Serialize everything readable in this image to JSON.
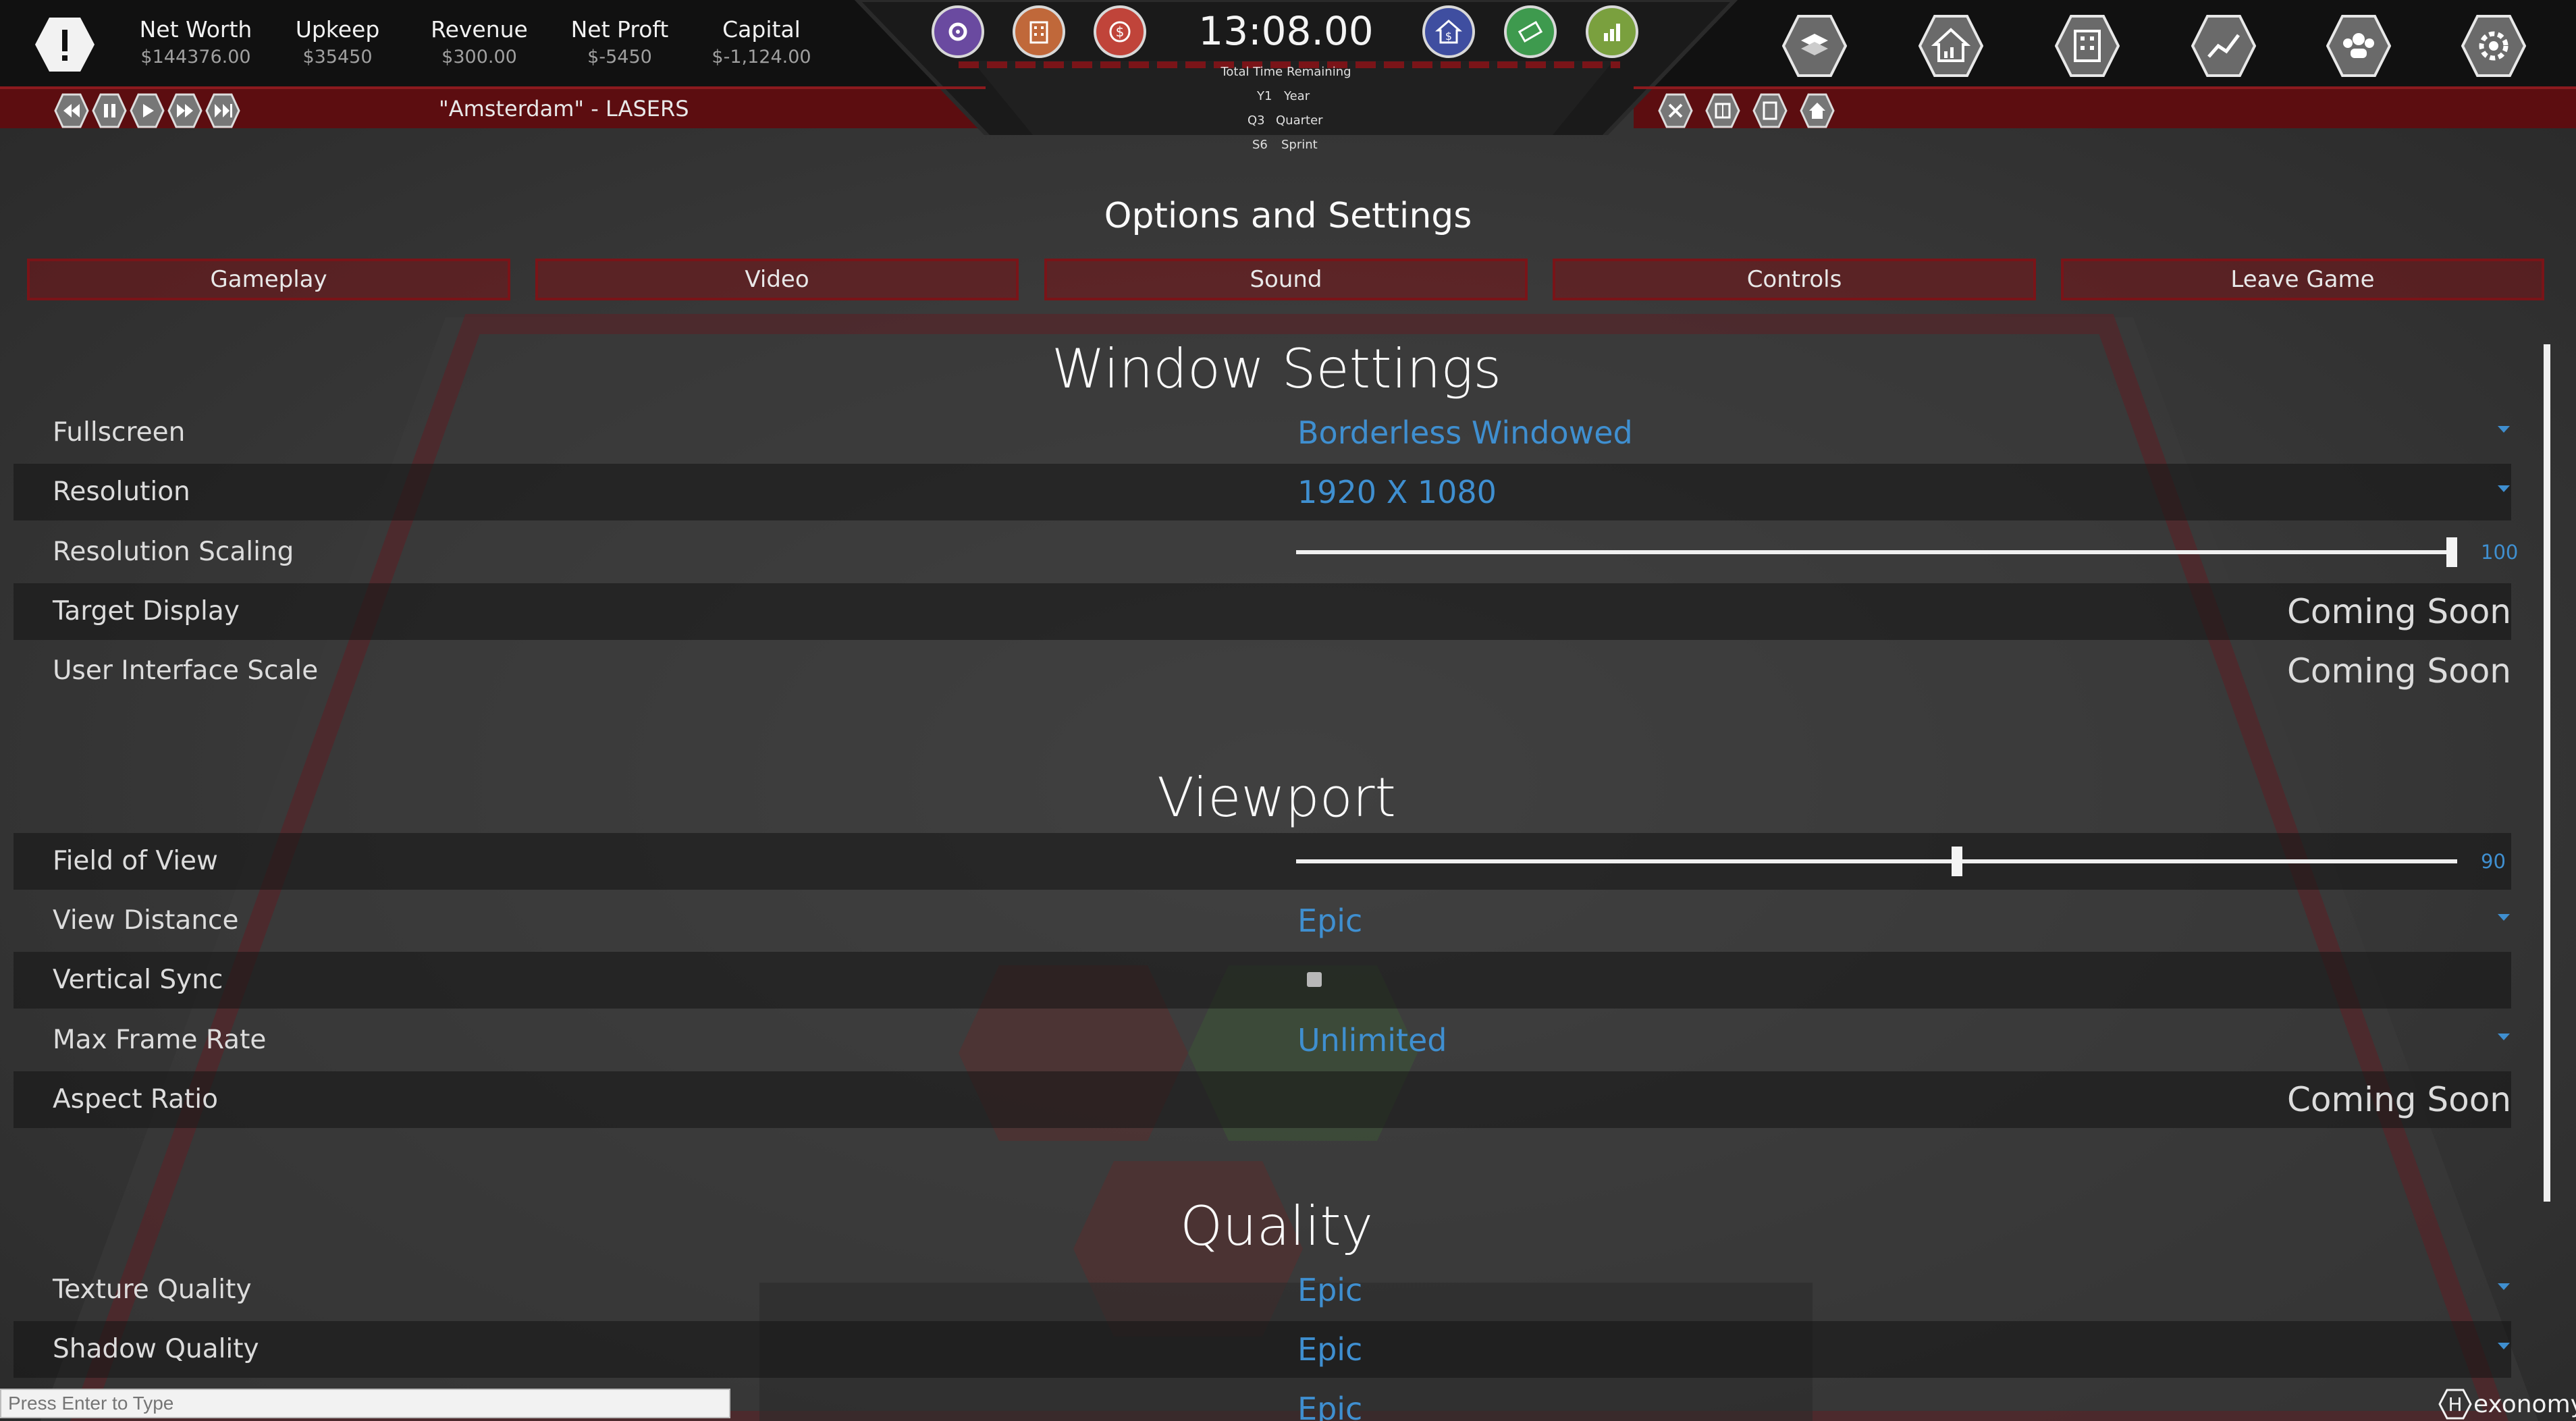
{
  "top_bar": {
    "stats": [
      {
        "label": "Net Worth",
        "value": "$144376.00"
      },
      {
        "label": "Upkeep",
        "value": "$35450"
      },
      {
        "label": "Revenue",
        "value": "$300.00"
      },
      {
        "label": "Net Proft",
        "value": "$-5450"
      },
      {
        "label": "Capital",
        "value": "$-1,124.00"
      }
    ],
    "clock": "13:08.00",
    "time_remaining_label": "Total Time Remaining",
    "time_rows": [
      {
        "code": "Y1",
        "label": "Year"
      },
      {
        "code": "Q3",
        "label": "Quarter"
      },
      {
        "code": "S6",
        "label": "Sprint"
      }
    ],
    "company_subtitle": "\"Amsterdam\"  - LASERS",
    "left_circle_icons": [
      "gear-icon",
      "building-icon",
      "dollar-icon"
    ],
    "right_circle_icons": [
      "house-dollar-icon",
      "money-icon",
      "growth-icon"
    ],
    "right_hex_icons": [
      "map-icon",
      "house-chart-icon",
      "office-icon",
      "trend-icon",
      "people-icon",
      "settings-gear-icon"
    ],
    "playback_icons": [
      "rewind-icon",
      "pause-icon",
      "play-icon",
      "fast-forward-icon",
      "skip-icon"
    ],
    "small_right_icons": [
      "close-icon",
      "grid-icon",
      "building-small-icon",
      "home-icon"
    ]
  },
  "options": {
    "title": "Options and Settings",
    "tabs": [
      "Gameplay",
      "Video",
      "Sound",
      "Controls",
      "Leave Game"
    ]
  },
  "sections": {
    "window": {
      "title": "Window Settings",
      "fullscreen_label": "Fullscreen",
      "fullscreen_value": "Borderless Windowed",
      "resolution_label": "Resolution",
      "resolution_value": "1920 X 1080",
      "scaling_label": "Resolution Scaling",
      "scaling_value": "100",
      "scaling_fraction": 1.0,
      "target_display_label": "Target Display",
      "target_display_value": "Coming Soon",
      "ui_scale_label": "User Interface Scale",
      "ui_scale_value": "Coming Soon"
    },
    "viewport": {
      "title": "Viewport",
      "fov_label": "Field of View",
      "fov_value": "90",
      "fov_fraction": 0.57,
      "view_distance_label": "View Distance",
      "view_distance_value": "Epic",
      "vsync_label": "Vertical Sync",
      "vsync_checked": false,
      "max_frame_label": "Max Frame Rate",
      "max_frame_value": "Unlimited",
      "aspect_label": "Aspect Ratio",
      "aspect_value": "Coming Soon"
    },
    "quality": {
      "title": "Quality",
      "texture_label": "Texture Quality",
      "texture_value": "Epic",
      "shadow_label": "Shadow Quality",
      "shadow_value": "Epic",
      "next_value_partial": "Epic"
    }
  },
  "chat": {
    "placeholder": "Press Enter to Type"
  },
  "brand": {
    "letter": "H",
    "rest": "exonomy"
  },
  "colors": {
    "accent_red": "#8a1a1e",
    "value_blue": "#3f8fd0",
    "panel_dark": "#1c1c1c"
  }
}
